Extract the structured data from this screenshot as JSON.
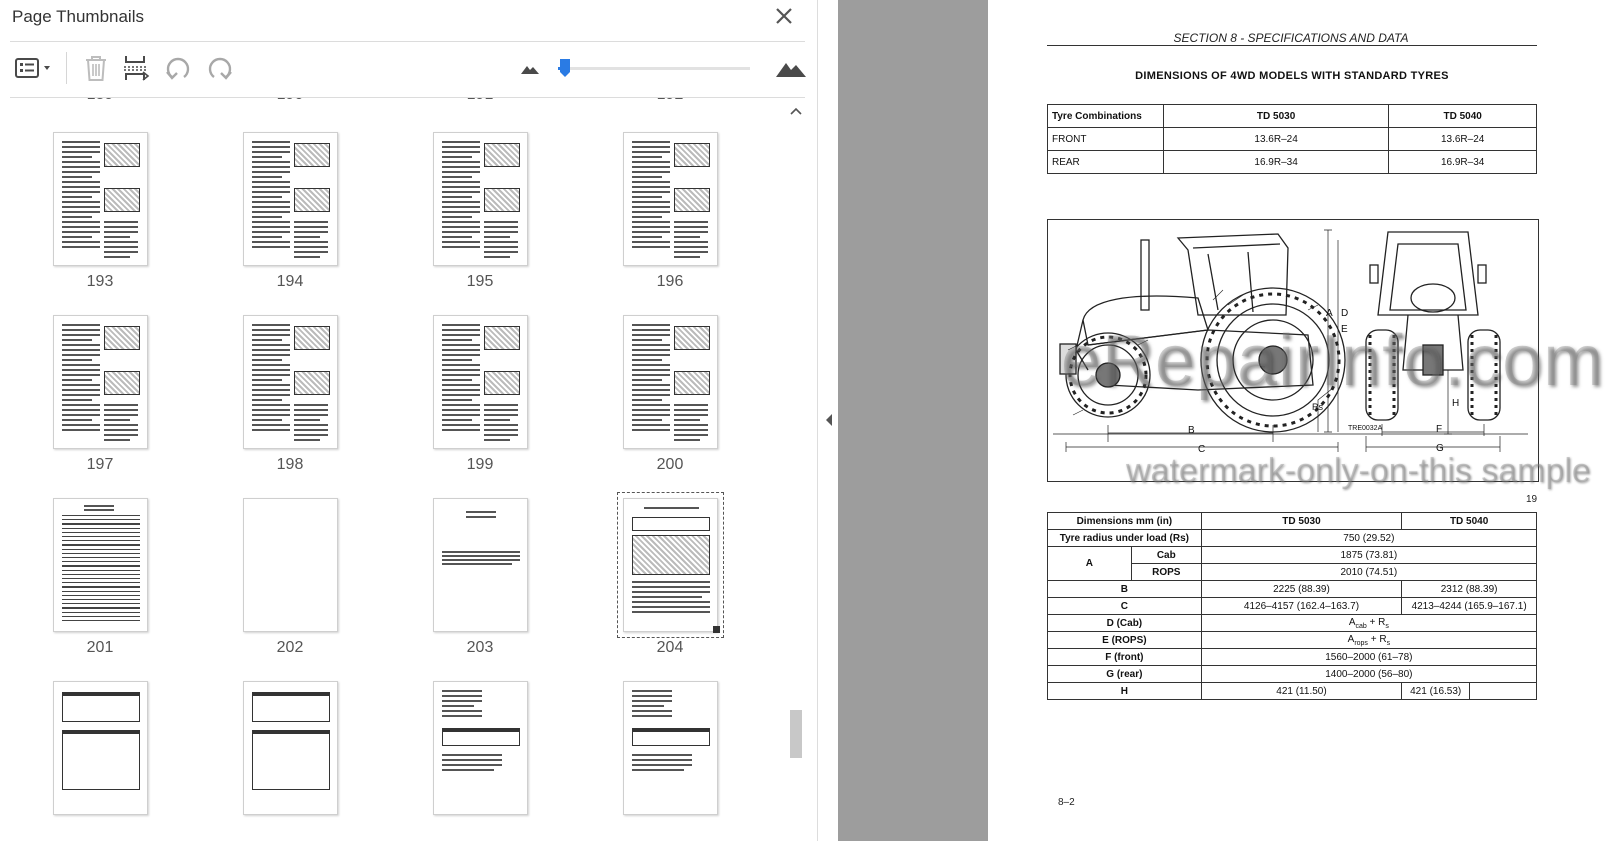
{
  "panel": {
    "title": "Page Thumbnails",
    "toolbar": {
      "options_icon": "list-options-icon",
      "delete_icon": "trash-icon",
      "insert_icon": "insert-pages-icon",
      "undo_icon": "rotate-left-icon",
      "redo_icon": "rotate-right-icon",
      "zoom_out_icon": "small-mountain-icon",
      "zoom_in_icon": "large-mountain-icon"
    },
    "slider_level": 0.04,
    "partial_row_labels": [
      "189",
      "190",
      "191",
      "192"
    ],
    "thumbnails": [
      {
        "label": "193",
        "kind": "text-images"
      },
      {
        "label": "194",
        "kind": "text-images"
      },
      {
        "label": "195",
        "kind": "text-images"
      },
      {
        "label": "196",
        "kind": "text-images"
      },
      {
        "label": "197",
        "kind": "text-images"
      },
      {
        "label": "198",
        "kind": "text-images"
      },
      {
        "label": "199",
        "kind": "text-images"
      },
      {
        "label": "200",
        "kind": "text-images"
      },
      {
        "label": "201",
        "kind": "lined"
      },
      {
        "label": "202",
        "kind": "blank"
      },
      {
        "label": "203",
        "kind": "section"
      },
      {
        "label": "204",
        "kind": "diagram",
        "selected": true
      },
      {
        "label": "",
        "kind": "tables"
      },
      {
        "label": "",
        "kind": "tables"
      },
      {
        "label": "",
        "kind": "text-table"
      },
      {
        "label": "",
        "kind": "text-table"
      }
    ]
  },
  "colors": {
    "accent": "#2a7be4",
    "viewer_bg": "#9d9d9d"
  },
  "document": {
    "header": "SECTION 8  - SPECIFICATIONS AND DATA",
    "heading": "DIMENSIONS OF 4WD MODELS WITH STANDARD TYRES",
    "tyre_table": {
      "headers": [
        "Tyre Combinations",
        "TD 5030",
        "TD 5040"
      ],
      "rows": [
        [
          "FRONT",
          "13.6R–24",
          "13.6R–24"
        ],
        [
          "REAR",
          "16.9R–34",
          "16.9R–34"
        ]
      ]
    },
    "figure": {
      "labels": {
        "a": "A",
        "d": "D",
        "e": "E",
        "rs": "Rs",
        "b": "B",
        "c": "C",
        "f": "F",
        "g": "G",
        "h": "H",
        "ref": "TRE0032A"
      },
      "number": "19"
    },
    "dim_table": {
      "headers": [
        "Dimensions mm (in)",
        "TD 5030",
        "TD 5040"
      ],
      "tyre_radius_label": "Tyre radius under load (Rs)",
      "tyre_radius_value": "750 (29.52)",
      "a_label": "A",
      "a_cab_label": "Cab",
      "a_cab_value": "1875 (73.81)",
      "a_rops_label": "ROPS",
      "a_rops_value": "2010 (74.51)",
      "b_label": "B",
      "b_5030": "2225 (88.39)",
      "b_5040": "2312 (88.39)",
      "c_label": "C",
      "c_5030": "4126–4157 (162.4–163.7)",
      "c_5040": "4213–4244 (165.9–167.1)",
      "d_label": "D (Cab)",
      "d_base": "A",
      "d_sub": "cab",
      "d_plus": " + R",
      "d_sub2": "s",
      "e_label": "E (ROPS)",
      "e_base": "A",
      "e_sub": "rops",
      "e_plus": " + R",
      "e_sub2": "s",
      "f_label": "F (front)",
      "f_value": "1560–2000 (61–78)",
      "g_label": "G (rear)",
      "g_value": "1400–2000 (56–80)",
      "h_label": "H",
      "h_5030": "421 (11.50)",
      "h_5040": "421 (16.53)"
    },
    "page_number": "8–2",
    "watermark_main": "eRepairInfo.com",
    "watermark_sub": "watermark-only-on-this sample"
  }
}
